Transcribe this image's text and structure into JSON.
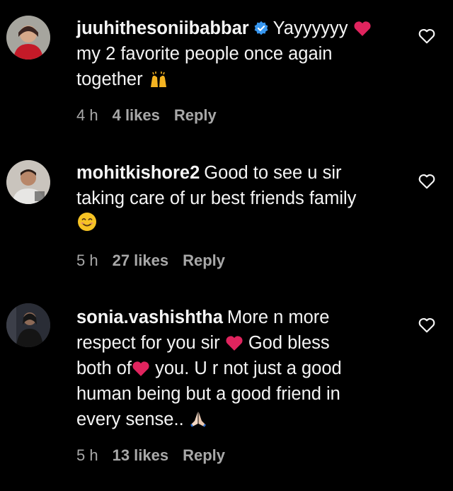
{
  "comments": [
    {
      "username": "juuhithesoniibabbar",
      "verified": true,
      "text_parts": [
        "Yayyyyyy",
        "my 2 favorite people once again",
        "together"
      ],
      "time": "4 h",
      "likes": "4 likes",
      "reply_label": "Reply",
      "icons": [
        "verified-badge-icon",
        "red-heart-emoji",
        "raised-hands-emoji",
        "heart-outline-icon"
      ]
    },
    {
      "username": "mohitkishore2",
      "verified": false,
      "text_parts": [
        "Good to see u sir",
        "taking care of ur best friends family"
      ],
      "time": "5 h",
      "likes": "27 likes",
      "reply_label": "Reply",
      "icons": [
        "smiling-face-emoji",
        "heart-outline-icon"
      ]
    },
    {
      "username": "sonia.vashishtha",
      "verified": false,
      "text_parts": [
        "More n more",
        "respect for you sir",
        "God bless",
        "both of",
        "you. U r not just a good",
        "human being but a good friend in",
        "every sense.."
      ],
      "time": "5 h",
      "likes": "13 likes",
      "reply_label": "Reply",
      "icons": [
        "red-heart-emoji",
        "folded-hands-emoji",
        "heart-outline-icon"
      ]
    }
  ],
  "colors": {
    "background": "#000000",
    "text": "#f5f5f5",
    "meta": "#a8a8a8",
    "verified": "#3897f0",
    "heart_emoji": "#e0245e"
  }
}
